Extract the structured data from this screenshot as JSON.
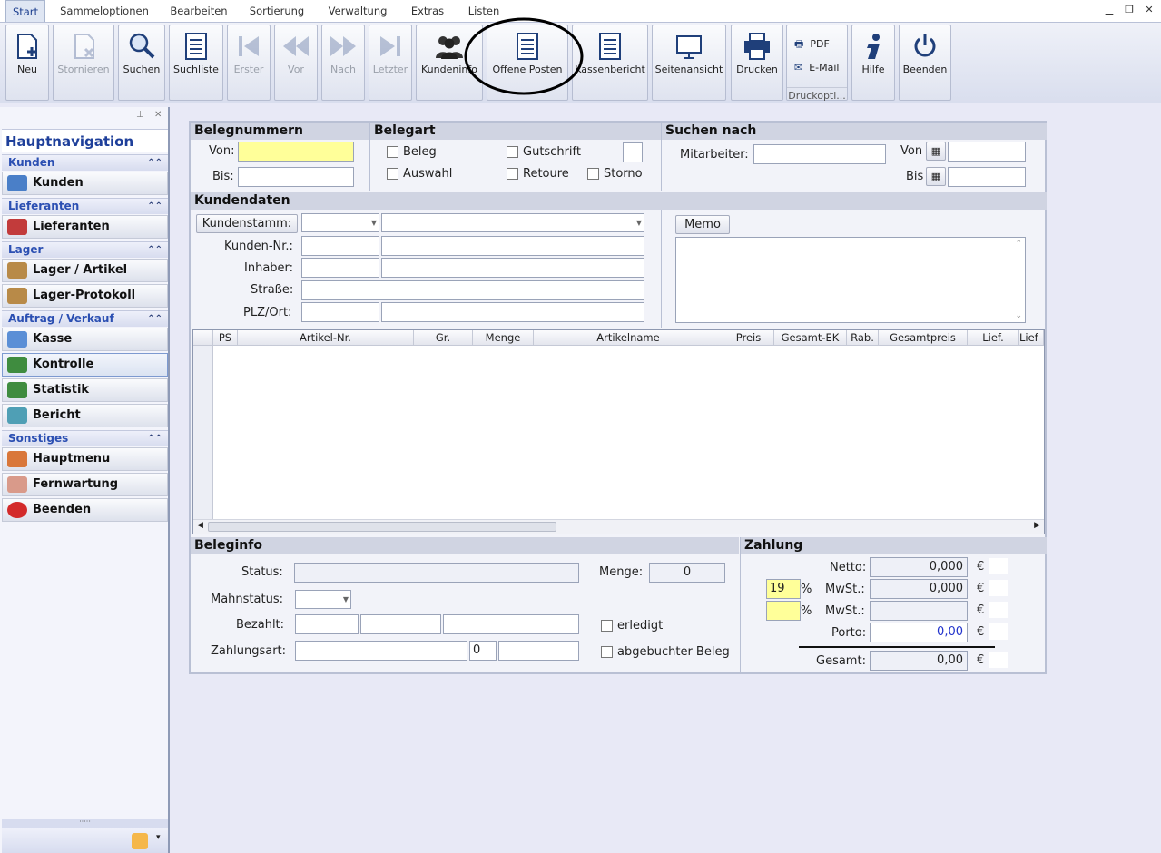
{
  "menu": {
    "tabs": [
      "Start",
      "Sammeloptionen",
      "Bearbeiten",
      "Sortierung",
      "Verwaltung",
      "Extras",
      "Listen"
    ]
  },
  "ribbon": {
    "buttons": [
      {
        "label": "Neu",
        "icon": "new-doc-icon"
      },
      {
        "label": "Stornieren",
        "icon": "cancel-doc-icon"
      },
      {
        "label": "Suchen",
        "icon": "search-icon"
      },
      {
        "label": "Suchliste",
        "icon": "list-doc-icon"
      },
      {
        "label": "Erster",
        "icon": "first-icon"
      },
      {
        "label": "Vor",
        "icon": "prev-icon"
      },
      {
        "label": "Nach",
        "icon": "next-icon"
      },
      {
        "label": "Letzter",
        "icon": "last-icon"
      },
      {
        "label": "Kundeninfo",
        "icon": "customers-icon"
      },
      {
        "label": "Offene Posten",
        "icon": "doc-icon"
      },
      {
        "label": "Kassenbericht",
        "icon": "doc-icon"
      },
      {
        "label": "Seitenansicht",
        "icon": "monitor-icon"
      },
      {
        "label": "Drucken",
        "icon": "printer-icon"
      },
      {
        "label": "Hilfe",
        "icon": "help-icon"
      },
      {
        "label": "Beenden",
        "icon": "power-icon"
      }
    ],
    "print_group": {
      "pdf": "PDF",
      "email": "E-Mail",
      "group_label": "Druckopti..."
    }
  },
  "sidebar": {
    "title": "Hauptnavigation",
    "groups": [
      {
        "label": "Kunden",
        "items": [
          "Kunden"
        ]
      },
      {
        "label": "Lieferanten",
        "items": [
          "Lieferanten"
        ]
      },
      {
        "label": "Lager",
        "items": [
          "Lager / Artikel",
          "Lager-Protokoll"
        ]
      },
      {
        "label": "Auftrag / Verkauf",
        "items": [
          "Kasse",
          "Kontrolle",
          "Statistik",
          "Bericht"
        ]
      },
      {
        "label": "Sonstiges",
        "items": [
          "Hauptmenu",
          "Fernwartung",
          "Beenden"
        ]
      }
    ]
  },
  "belegnummern": {
    "title": "Belegnummern",
    "von": "Von:",
    "bis": "Bis:"
  },
  "belegart": {
    "title": "Belegart",
    "beleg": "Beleg",
    "auswahl": "Auswahl",
    "gutschrift": "Gutschrift",
    "retoure": "Retoure",
    "storno": "Storno"
  },
  "suchen": {
    "title": "Suchen nach",
    "mitarbeiter": "Mitarbeiter:",
    "von": "Von",
    "bis": "Bis"
  },
  "kunden": {
    "title": "Kundendaten",
    "stamm_button": "Kundenstamm:",
    "nr": "Kunden-Nr.:",
    "inhaber": "Inhaber:",
    "strasse": "Straße:",
    "plz": "PLZ/Ort:",
    "memo": "Memo"
  },
  "grid": {
    "columns": [
      "PS",
      "Artikel-Nr.",
      "Gr.",
      "Menge",
      "Artikelname",
      "Preis",
      "Gesamt-EK",
      "Rab.",
      "Gesamtpreis",
      "Lief.",
      "Lief"
    ]
  },
  "beleginfo": {
    "title": "Beleginfo",
    "status": "Status:",
    "mahnstatus": "Mahnstatus:",
    "bezahlt": "Bezahlt:",
    "zahlungsart": "Zahlungsart:",
    "zahlungsart_code": "0",
    "menge_label": "Menge:",
    "menge_value": "0",
    "erledigt": "erledigt",
    "abgebucht": "abgebuchter Beleg"
  },
  "zahlung": {
    "title": "Zahlung",
    "netto_label": "Netto:",
    "netto": "0,000",
    "mwst_label": "MwSt.:",
    "mwst1_rate": "19",
    "mwst1": "0,000",
    "mwst2_rate": "",
    "mwst2": "",
    "pct": "%",
    "porto_label": "Porto:",
    "porto": "0,00",
    "gesamt_label": "Gesamt:",
    "gesamt": "0,00",
    "currency": "€"
  }
}
